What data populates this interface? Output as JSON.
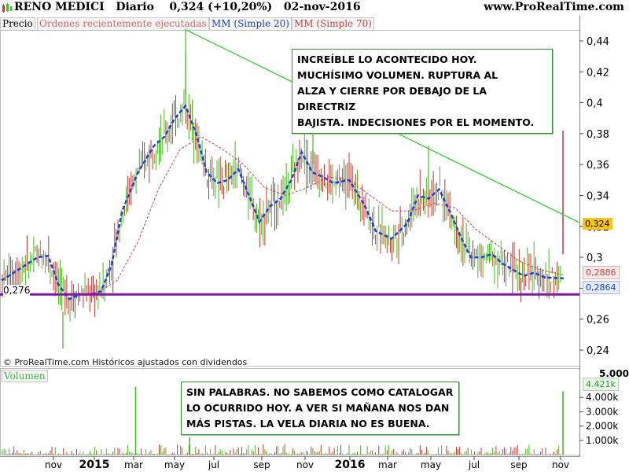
{
  "header": {
    "title": "RENO MEDICI   Diario    0,324 (+10,20%)   02-nov-2016",
    "site": "www.ProRealTime.com"
  },
  "legend": {
    "price": "Precio",
    "orders": "Ordenes recientemente ejecutadas",
    "ma20": "MM (Simple 20)",
    "ma70": "MM (Simple 70)"
  },
  "notes": {
    "top": "INCREÍBLE LO ACONTECIDO HOY.\nMUCHÍSIMO VOLUMEN. RUPTURA AL\nALZA Y CIERRE POR DEBAJO DE LA DIRECTRIZ\nBAJISTA. INDECISIONES POR EL MOMENTO.",
    "bottom": "SIN PALABRAS. NO SABEMOS COMO CATALOGAR\nLO OCURRIDO HOY. A VER SI MAÑANA NOS DAN\nMÁS PISTAS. LA VELA DIARIA NO ES BUENA."
  },
  "footer": "© ProRealTime.com  Históricos ajustados con dividendos",
  "volume_label": "Volumen",
  "support_label": "0,276",
  "price_tags": {
    "last": "0,324",
    "ma70": "0,2886",
    "ma20": "0,2864",
    "volume": "4.421k",
    "volume_top": "5.000k"
  },
  "colors": {
    "up": "#44bb22",
    "down": "#cc3333",
    "ma20": "#1a44cc",
    "ma70": "#cc4444",
    "trendline": "#33cc33",
    "support": "#7a1aa0",
    "last_tag": "#f5c518"
  },
  "chart_data": [
    {
      "type": "candlestick",
      "title": "RENO MEDICI Diario",
      "y_ticks": [
        "0,44",
        "0,42",
        "0,4",
        "0,38",
        "0,36",
        "0,34",
        "0,32",
        "0,3",
        "0,28",
        "0,26",
        "0,24"
      ],
      "ylim": [
        0.23,
        0.45
      ],
      "x_ticks": [
        "nov",
        "2015",
        "mar",
        "may",
        "jul",
        "sep",
        "nov",
        "2016",
        "mar",
        "may",
        "jul",
        "sep",
        "nov"
      ],
      "last_close": 0.324,
      "change_pct": 10.2,
      "ma20_last": 0.2864,
      "ma70_last": 0.2886,
      "support_level": 0.276,
      "trendline": [
        {
          "x": "may 2015",
          "y": 0.447
        },
        {
          "x": "nov 2016",
          "y": 0.324
        }
      ],
      "ma20_path": [
        [
          "oct 2014",
          0.285
        ],
        [
          "oct 2014",
          0.3
        ],
        [
          "nov 2014",
          0.301
        ],
        [
          "nov 2014",
          0.282
        ],
        [
          "dec 2014",
          0.273
        ],
        [
          "dec 2014",
          0.276
        ],
        [
          "jan 2015",
          0.276
        ],
        [
          "jan 2015",
          0.278
        ],
        [
          "feb 2015",
          0.295
        ],
        [
          "feb 2015",
          0.33
        ],
        [
          "mar 2015",
          0.355
        ],
        [
          "apr 2015",
          0.372
        ],
        [
          "apr 2015",
          0.378
        ],
        [
          "may 2015",
          0.39
        ],
        [
          "may 2015",
          0.398
        ],
        [
          "jun 2015",
          0.38
        ],
        [
          "jun 2015",
          0.355
        ],
        [
          "jul 2015",
          0.348
        ],
        [
          "jul 2015",
          0.35
        ],
        [
          "aug 2015",
          0.357
        ],
        [
          "aug 2015",
          0.34
        ],
        [
          "sep 2015",
          0.323
        ],
        [
          "sep 2015",
          0.333
        ],
        [
          "oct 2015",
          0.338
        ],
        [
          "oct 2015",
          0.35
        ],
        [
          "nov 2015",
          0.368
        ],
        [
          "nov 2015",
          0.355
        ],
        [
          "dec 2015",
          0.352
        ],
        [
          "dec 2015",
          0.348
        ],
        [
          "jan 2016",
          0.35
        ],
        [
          "feb 2016",
          0.333
        ],
        [
          "feb 2016",
          0.317
        ],
        [
          "mar 2016",
          0.312
        ],
        [
          "apr 2016",
          0.322
        ],
        [
          "apr 2016",
          0.34
        ],
        [
          "may 2016",
          0.338
        ],
        [
          "may 2016",
          0.344
        ],
        [
          "jun 2016",
          0.33
        ],
        [
          "jun 2016",
          0.314
        ],
        [
          "jul 2016",
          0.3
        ],
        [
          "jul 2016",
          0.3
        ],
        [
          "aug 2016",
          0.302
        ],
        [
          "aug 2016",
          0.296
        ],
        [
          "sep 2016",
          0.292
        ],
        [
          "sep 2016",
          0.288
        ],
        [
          "oct 2016",
          0.29
        ],
        [
          "oct 2016",
          0.287
        ],
        [
          "nov 2016",
          0.2864
        ]
      ],
      "ma70_path": [
        [
          "jan 2015",
          0.276
        ],
        [
          "feb 2015",
          0.285
        ],
        [
          "mar 2015",
          0.31
        ],
        [
          "apr 2015",
          0.345
        ],
        [
          "may 2015",
          0.37
        ],
        [
          "jun 2015",
          0.378
        ],
        [
          "jul 2015",
          0.37
        ],
        [
          "aug 2015",
          0.36
        ],
        [
          "sep 2015",
          0.345
        ],
        [
          "oct 2015",
          0.34
        ],
        [
          "nov 2015",
          0.345
        ],
        [
          "dec 2015",
          0.352
        ],
        [
          "jan 2016",
          0.35
        ],
        [
          "feb 2016",
          0.34
        ],
        [
          "mar 2016",
          0.33
        ],
        [
          "apr 2016",
          0.33
        ],
        [
          "may 2016",
          0.335
        ],
        [
          "jun 2016",
          0.332
        ],
        [
          "jul 2016",
          0.318
        ],
        [
          "aug 2016",
          0.308
        ],
        [
          "sep 2016",
          0.298
        ],
        [
          "oct 2016",
          0.292
        ],
        [
          "nov 2016",
          0.2886
        ]
      ]
    },
    {
      "type": "bar",
      "title": "Volumen",
      "y_ticks": [
        "5.000k",
        "4.000k",
        "3.000k",
        "2.000k",
        "1.000k"
      ],
      "ylim": [
        0,
        5000
      ],
      "last_volume_k": 4421,
      "notable_spikes": [
        {
          "x": "mar 2015",
          "value_k": 4750
        },
        {
          "x": "may 2015",
          "value_k": 1200
        },
        {
          "x": "nov 2016",
          "value_k": 4421
        }
      ]
    }
  ]
}
